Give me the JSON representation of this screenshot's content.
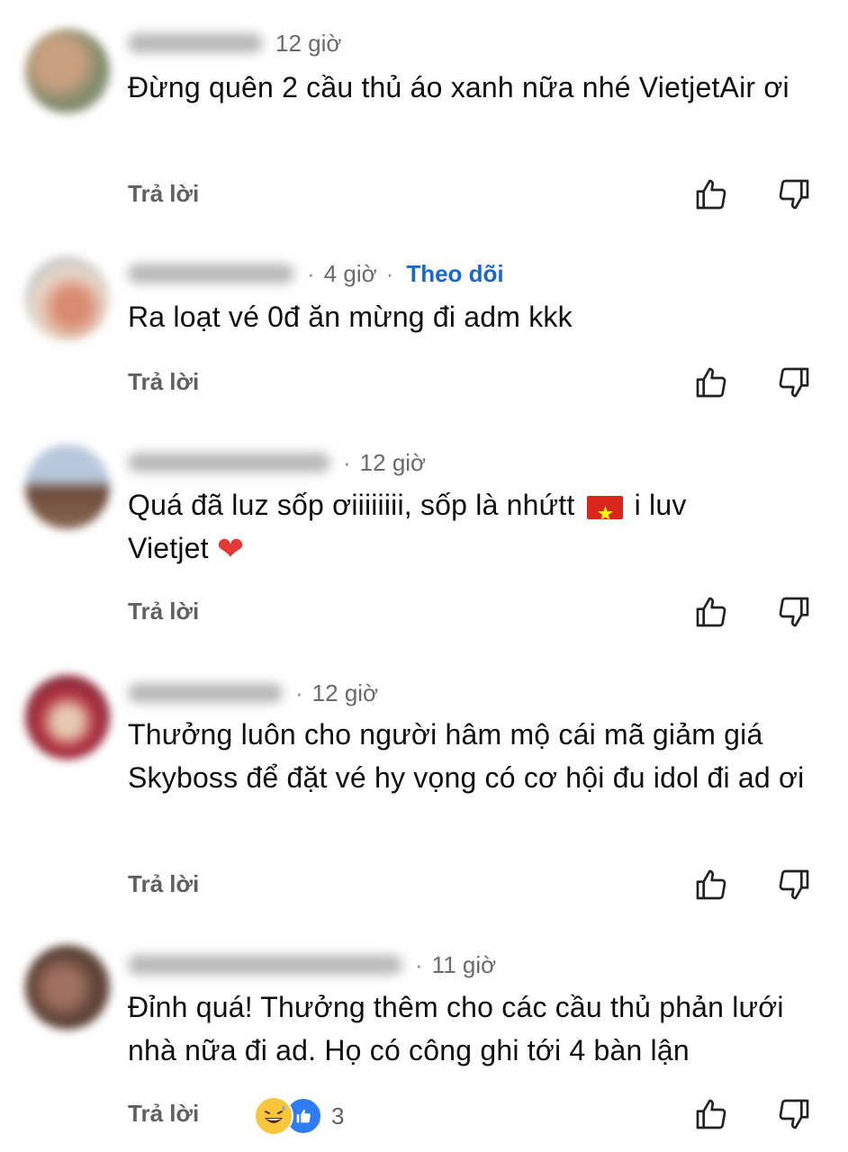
{
  "comments": [
    {
      "time": "12 giờ",
      "follow": "",
      "text": "Đừng quên 2 cầu thủ áo xanh nữa nhé VietjetAir ơi",
      "reply": "Trả lời",
      "reactions": ""
    },
    {
      "time": "4 giờ",
      "follow": "Theo dõi",
      "text": "Ra loạt vé 0đ ăn mừng đi adm kkk",
      "reply": "Trả lời",
      "reactions": ""
    },
    {
      "time": "12 giờ",
      "follow": "",
      "text_part1": "Quá đã luz sốp ơiiiiiiii, sốp là nhứtt",
      "text_part2": " i luv Vietjet ",
      "reply": "Trả lời",
      "reactions": ""
    },
    {
      "time": "12 giờ",
      "follow": "",
      "text": "Thưởng luôn cho người hâm mộ cái mã giảm giá Skyboss để đặt vé hy vọng có cơ hội đu idol đi ad ơi",
      "reply": "Trả lời",
      "reactions": ""
    },
    {
      "time": "11 giờ",
      "follow": "",
      "text": "Đỉnh quá! Thưởng thêm cho các cầu thủ phản lưới nhà nữa đi ad. Họ có công ghi tới 4 bàn lận",
      "reply": "Trả lời",
      "reactions": "3"
    }
  ],
  "icons": {
    "like": "thumbs-up-outline",
    "dislike": "thumbs-down-outline",
    "reaction_1": "grinning-sweat-emoji",
    "reaction_2": "facebook-like",
    "flag": "vietnam-flag",
    "heart": "red-heart"
  },
  "colors": {
    "follow": "#1a67d2",
    "meta": "#6b6b6b",
    "reply": "#606060",
    "like_reaction": "#2d7cf6"
  }
}
